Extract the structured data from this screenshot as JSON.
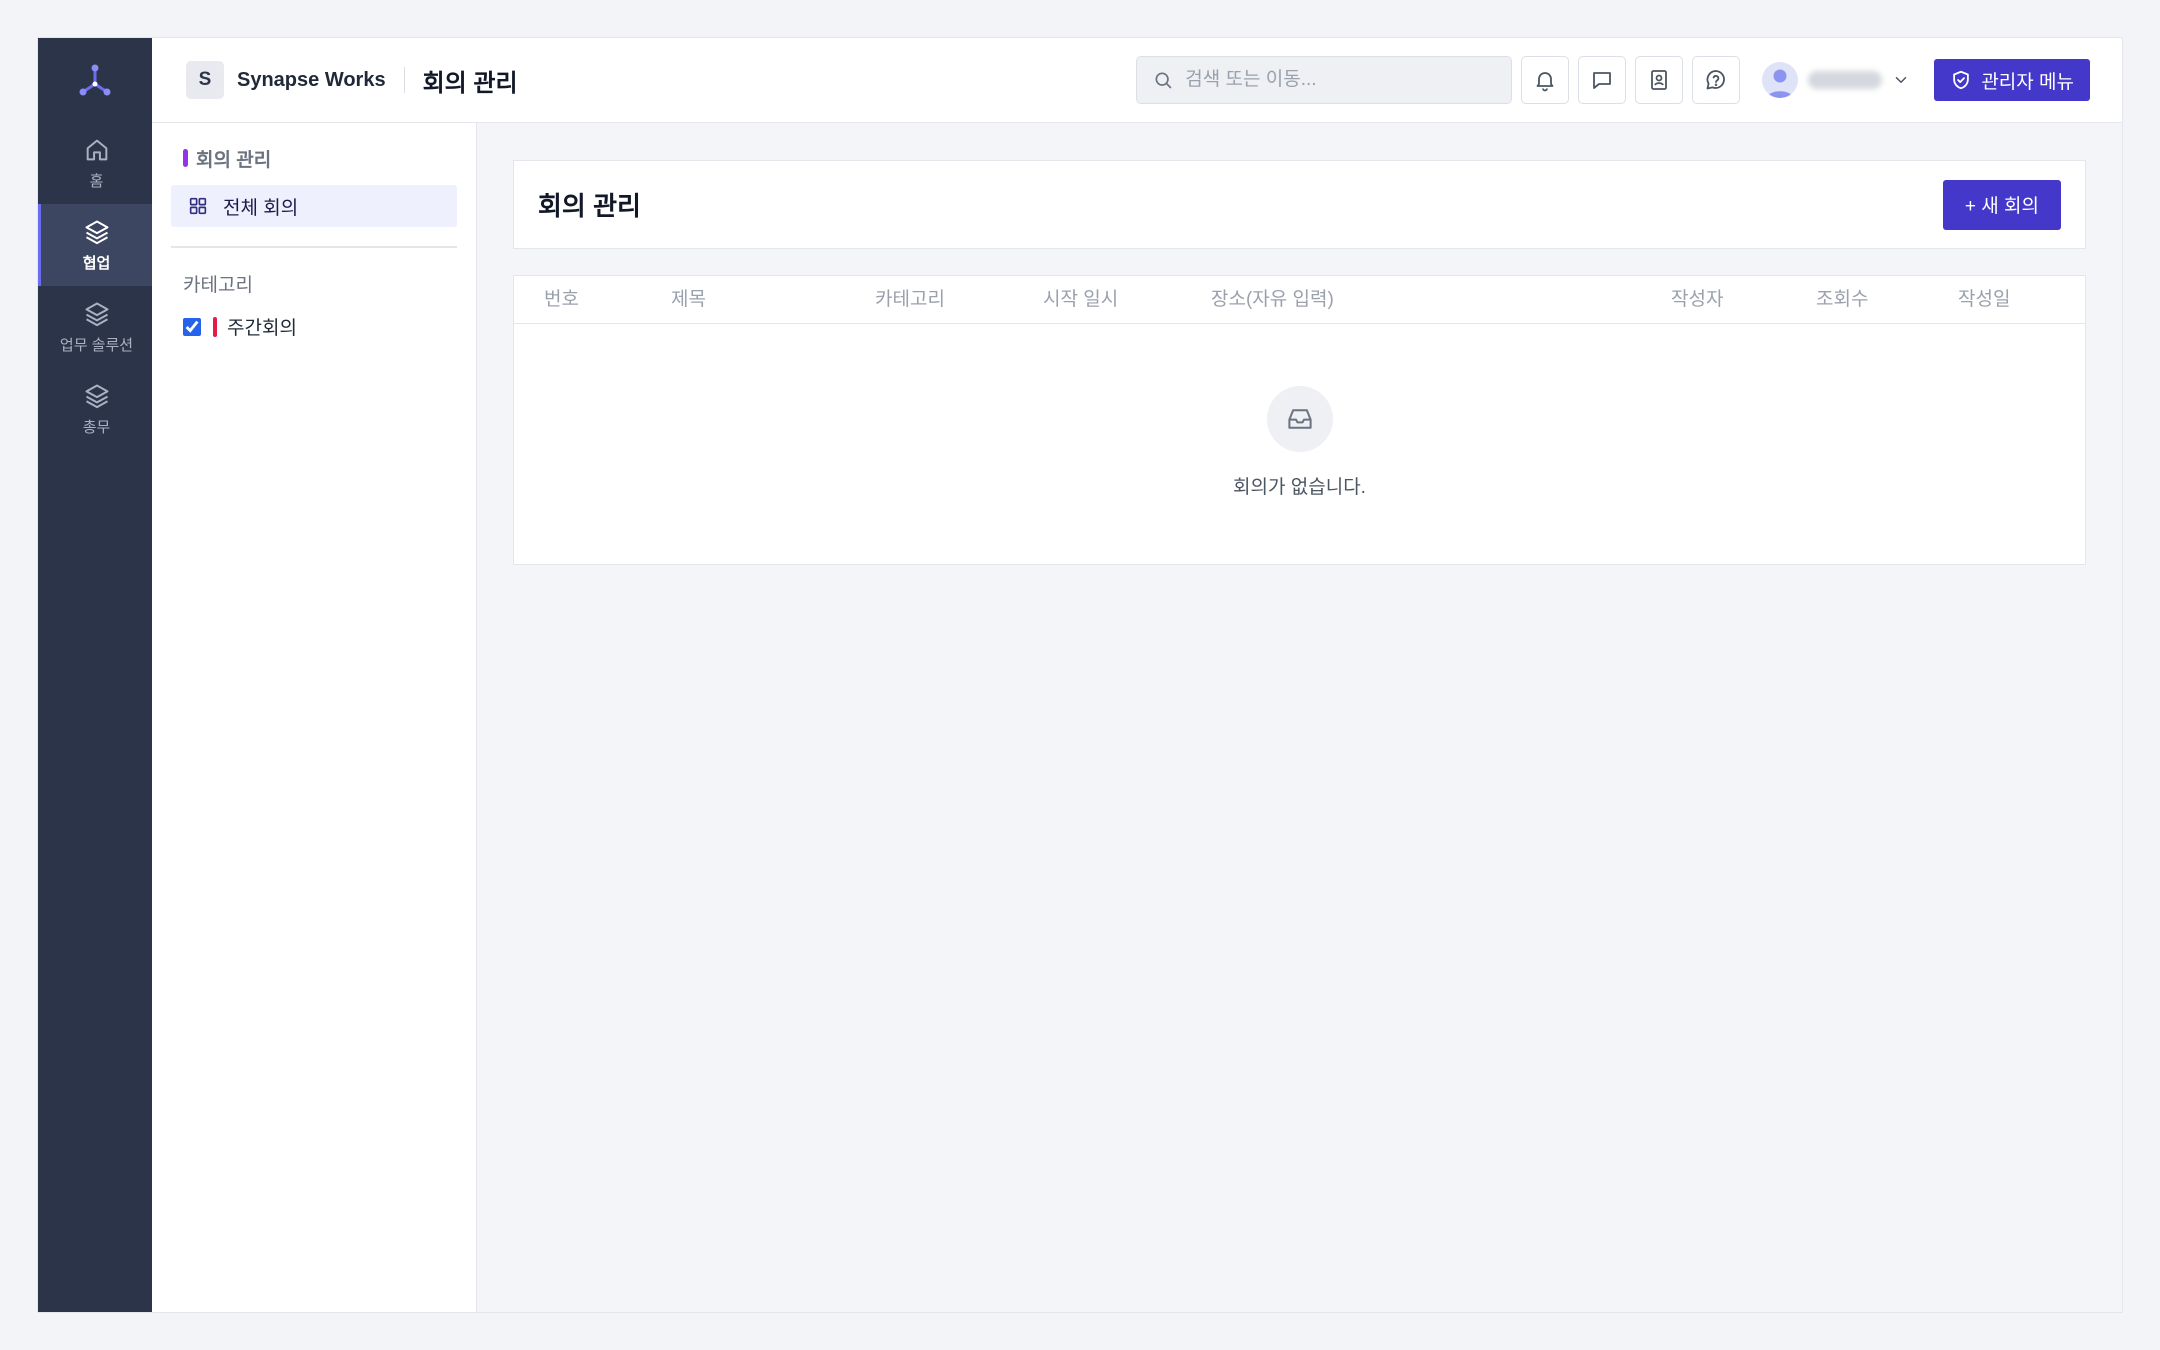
{
  "rail": {
    "items": [
      {
        "label": "홈",
        "icon": "home-icon"
      },
      {
        "label": "협업",
        "icon": "layers-icon",
        "active": true
      },
      {
        "label": "업무 솔루션",
        "icon": "layers-icon"
      },
      {
        "label": "총무",
        "icon": "layers-icon"
      }
    ]
  },
  "topbar": {
    "org_initial": "S",
    "org_name": "Synapse Works",
    "page_title": "회의 관리",
    "search_placeholder": "검색 또는 이동...",
    "admin_label": "관리자 메뉴"
  },
  "subnav": {
    "section_title": "회의 관리",
    "all_item_label": "전체 회의",
    "category_title": "카테고리",
    "categories": [
      {
        "label": "주간회의",
        "checked": true,
        "color": "#e11d48"
      }
    ]
  },
  "content": {
    "title": "회의 관리",
    "new_button_label": "+ 새 회의",
    "columns": [
      "번호",
      "제목",
      "카테고리",
      "시작 일시",
      "장소(자유 입력)",
      "작성자",
      "조회수",
      "작성일"
    ],
    "empty_text": "회의가 없습니다."
  },
  "colors": {
    "rail_bg": "#2c344a",
    "accent": "#4338ca",
    "section_accent": "#9333ea"
  }
}
